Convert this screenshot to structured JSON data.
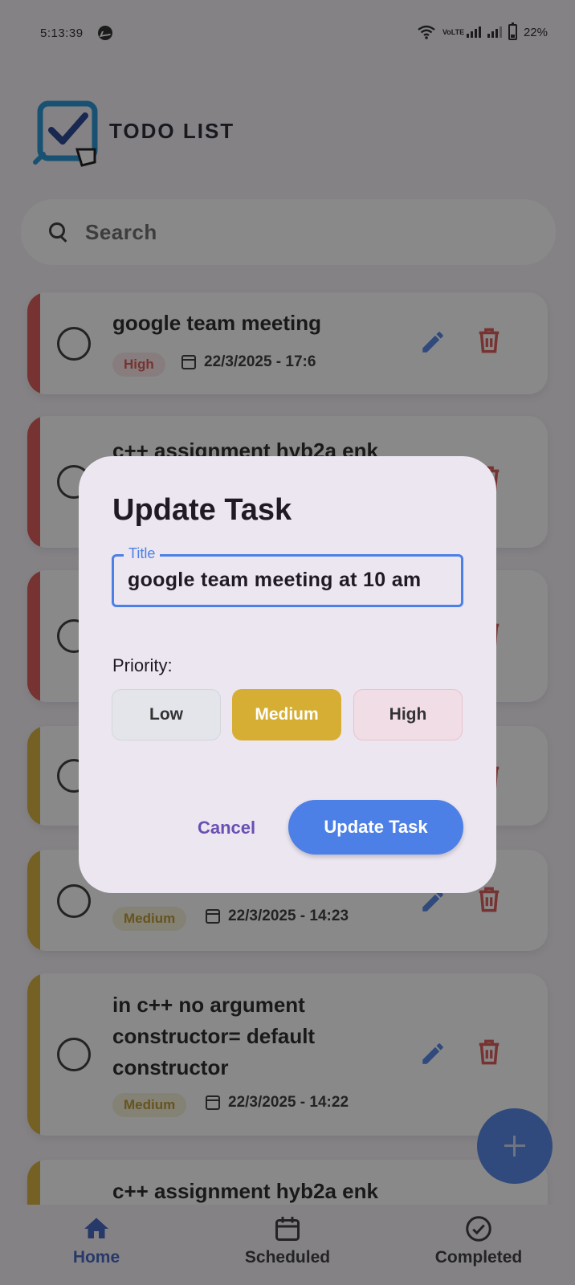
{
  "status_bar": {
    "time": "5:13:39",
    "battery": "22%",
    "network_label": "VoLTE"
  },
  "app": {
    "logo_text": "TODO LIST"
  },
  "search": {
    "placeholder": "Search"
  },
  "tasks": [
    {
      "title": "google team meeting",
      "priority": "High",
      "date": "22/3/2025 - 17:6"
    },
    {
      "title": "c++ assignment hyb2a enk",
      "priority": "High",
      "date": ""
    },
    {
      "title": "",
      "priority": "High",
      "date": ""
    },
    {
      "title": "",
      "priority": "Medium",
      "date": ""
    },
    {
      "title": "",
      "priority": "Medium",
      "date": "22/3/2025 - 14:23"
    },
    {
      "title": "in c++ no argument constructor= default constructor",
      "priority": "Medium",
      "date": "22/3/2025 - 14:22"
    },
    {
      "title": "c++ assignment hyb2a enk",
      "priority": "Medium",
      "date": ""
    }
  ],
  "dialog": {
    "title": "Update Task",
    "field_label": "Title",
    "field_value": "google team meeting at 10 am",
    "priority_label": "Priority:",
    "priorities": [
      "Low",
      "Medium",
      "High"
    ],
    "selected_priority": "Medium",
    "cancel_label": "Cancel",
    "confirm_label": "Update Task"
  },
  "nav": {
    "items": [
      {
        "label": "Home",
        "icon": "home-icon",
        "active": true
      },
      {
        "label": "Scheduled",
        "icon": "calendar-icon",
        "active": false
      },
      {
        "label": "Completed",
        "icon": "check-circle-icon",
        "active": false
      }
    ]
  },
  "colors": {
    "high": "#d9534f",
    "medium": "#d6ae34",
    "accent": "#4d80e6",
    "dialog_bg": "#ece6f1"
  }
}
